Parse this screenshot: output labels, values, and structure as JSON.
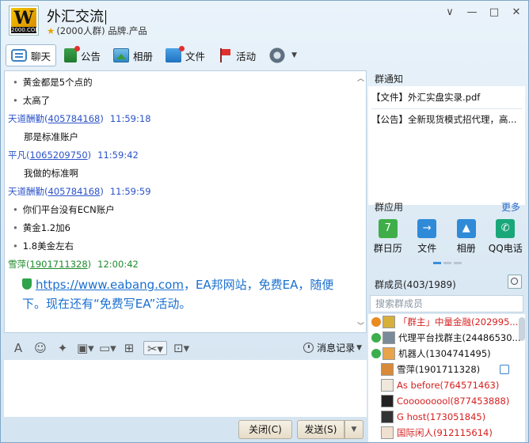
{
  "header": {
    "logo_text": "2000.COM",
    "group_name": "外汇交流",
    "sub": "(2000人群) 品牌.产品"
  },
  "window_buttons": [
    "∨",
    "—",
    "□",
    "✕"
  ],
  "toolbar": {
    "chat": "聊天",
    "notice": "公告",
    "album": "相册",
    "file": "文件",
    "activity": "活动"
  },
  "chat": {
    "lines": [
      {
        "type": "msg",
        "text": "黄金都是5个点的"
      },
      {
        "type": "msg",
        "text": "太高了"
      },
      {
        "type": "sender",
        "name": "天道酬勤",
        "qq": "405784168",
        "time": "11:59:18"
      },
      {
        "type": "msg_plain",
        "text": "那是标准账户"
      },
      {
        "type": "sender",
        "name": "平凡",
        "qq": "1065209750",
        "time": "11:59:42"
      },
      {
        "type": "msg_plain",
        "text": "我做的标准啊"
      },
      {
        "type": "sender",
        "name": "天道酬勤",
        "qq": "405784168",
        "time": "11:59:59"
      },
      {
        "type": "msg",
        "text": "你们平台没有ECN账户"
      },
      {
        "type": "msg",
        "text": "黄金1.2加6"
      },
      {
        "type": "msg",
        "text": "1.8美金左右"
      },
      {
        "type": "sender_green",
        "name": "雪萍",
        "qq": "1901711328",
        "time": "12:00:42"
      }
    ],
    "ad_url": "https://www.eabang.com",
    "ad_text": "，EA邦网站，免费EA，随便下。现在还有“免费写EA”活动。"
  },
  "input": {
    "history_label": "消息记录",
    "close_label": "关闭(C)",
    "send_label": "发送(S)"
  },
  "right": {
    "notice_title": "群通知",
    "notices": [
      "【文件】外汇实盘实录.pdf",
      "【公告】全新现货模式招代理，高..."
    ],
    "apps_title": "群应用",
    "more_label": "更多",
    "apps": [
      {
        "label": "群日历",
        "color": "#3fae49",
        "glyph": "7"
      },
      {
        "label": "文件",
        "color": "#2f8ad8",
        "glyph": "→"
      },
      {
        "label": "相册",
        "color": "#2f8ad8",
        "glyph": "▲"
      },
      {
        "label": "QQ电话",
        "color": "#19a77a",
        "glyph": "✆"
      }
    ],
    "members_title": "群成员(403/1989)",
    "member_search_placeholder": "搜索群成员",
    "members": [
      {
        "role": "owner",
        "text": "「群主」中量金融(202995...",
        "cls": "red",
        "avatar": "#d7b03a"
      },
      {
        "role": "admin",
        "text": "代理平台找群主(24486530...",
        "cls": "black",
        "avatar": "#7b8a99"
      },
      {
        "role": "admin",
        "text": "机器人(1304741495)",
        "cls": "black",
        "avatar": "#e8a44a"
      },
      {
        "role": "none",
        "text": "雪萍(1901711328)",
        "cls": "black",
        "avatar": "#d88a3a"
      },
      {
        "role": "none",
        "text": "As before(764571463)",
        "cls": "red",
        "avatar": "#f0e8dc"
      },
      {
        "role": "none",
        "text": "Cooooooool(877453888)",
        "cls": "red",
        "avatar": "#222222"
      },
      {
        "role": "none",
        "text": "G host(173051845)",
        "cls": "red",
        "avatar": "#333333"
      },
      {
        "role": "none",
        "text": "国际闲人(912115614)",
        "cls": "red",
        "avatar": "#f0e0d0"
      }
    ]
  }
}
